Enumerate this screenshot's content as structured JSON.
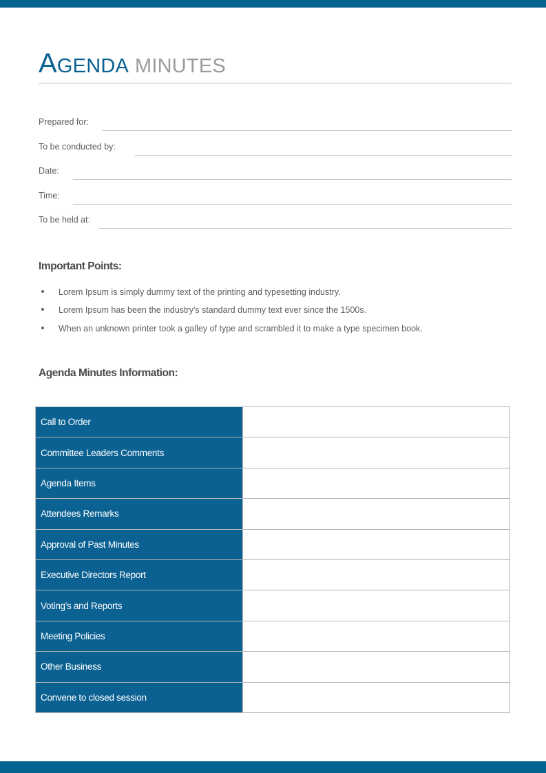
{
  "theme": {
    "accent_blue": "#046491",
    "table_blue": "#0a6192",
    "title_gray": "#9b9b9b",
    "heading_gray": "#4a4a4a",
    "body_gray": "#5c5c5c"
  },
  "title": {
    "primary_initial": "A",
    "primary_rest": "GENDA",
    "secondary": "MINUTES"
  },
  "fields": [
    {
      "label": "Prepared for:",
      "value": ""
    },
    {
      "label": "To be conducted by:",
      "value": ""
    },
    {
      "label": "Date:",
      "value": ""
    },
    {
      "label": "Time:",
      "value": ""
    },
    {
      "label": "To be held at:",
      "value": ""
    }
  ],
  "important_points": {
    "heading": "Important Points:",
    "items": [
      "Lorem Ipsum is simply dummy text of the printing and typesetting industry.",
      "Lorem Ipsum has been the industry's standard dummy text ever since the 1500s.",
      "When an unknown printer took a galley of type and scrambled it to make a type specimen book."
    ]
  },
  "agenda_table": {
    "heading": "Agenda Minutes Information:",
    "rows": [
      {
        "label": "Call to Order",
        "value": ""
      },
      {
        "label": "Committee Leaders Comments",
        "value": ""
      },
      {
        "label": "Agenda Items",
        "value": ""
      },
      {
        "label": "Attendees Remarks",
        "value": ""
      },
      {
        "label": "Approval of Past Minutes",
        "value": ""
      },
      {
        "label": "Executive Directors Report",
        "value": ""
      },
      {
        "label": "Voting's and Reports",
        "value": ""
      },
      {
        "label": "Meeting Policies",
        "value": ""
      },
      {
        "label": "Other Business",
        "value": ""
      },
      {
        "label": "Convene to closed session",
        "value": ""
      }
    ]
  }
}
